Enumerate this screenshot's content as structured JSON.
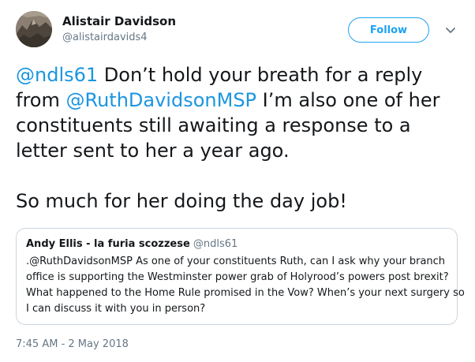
{
  "author": {
    "name": "Alistair Davidson",
    "handle": "@alistairdavids4",
    "avatar_icon": "profile-photo-icon"
  },
  "follow_label": "Follow",
  "tweet": {
    "line1_mention": "@ndls61",
    "line1_rest": " Don’t hold your breath for a reply",
    "line2_prefix": "from ",
    "line2_mention": "@RuthDavidsonMSP",
    "line2_rest": " I’m also one of her",
    "line3": "constituents still awaiting a response to a",
    "line4": "letter sent to her a year ago.",
    "line5": "So much for her doing the day job!"
  },
  "quote": {
    "name": "Andy Ellis - la furia scozzese",
    "handle": "@ndls61",
    "lines": [
      ".@RuthDavidsonMSP As one of your constituents Ruth, can I ask why your branch",
      "office is supporting the Westminster power grab of Holyrood’s powers post brexit?",
      "What happened to the Home Rule promised in the Vow? When’s your next surgery so",
      "I can discuss it with you in person?"
    ]
  },
  "timestamp": "7:45 AM - 2 May 2018",
  "colors": {
    "accent": "#1da1f2",
    "mention": "#1b95e0",
    "secondary_text": "#657786",
    "border": "#ccd6dd"
  }
}
